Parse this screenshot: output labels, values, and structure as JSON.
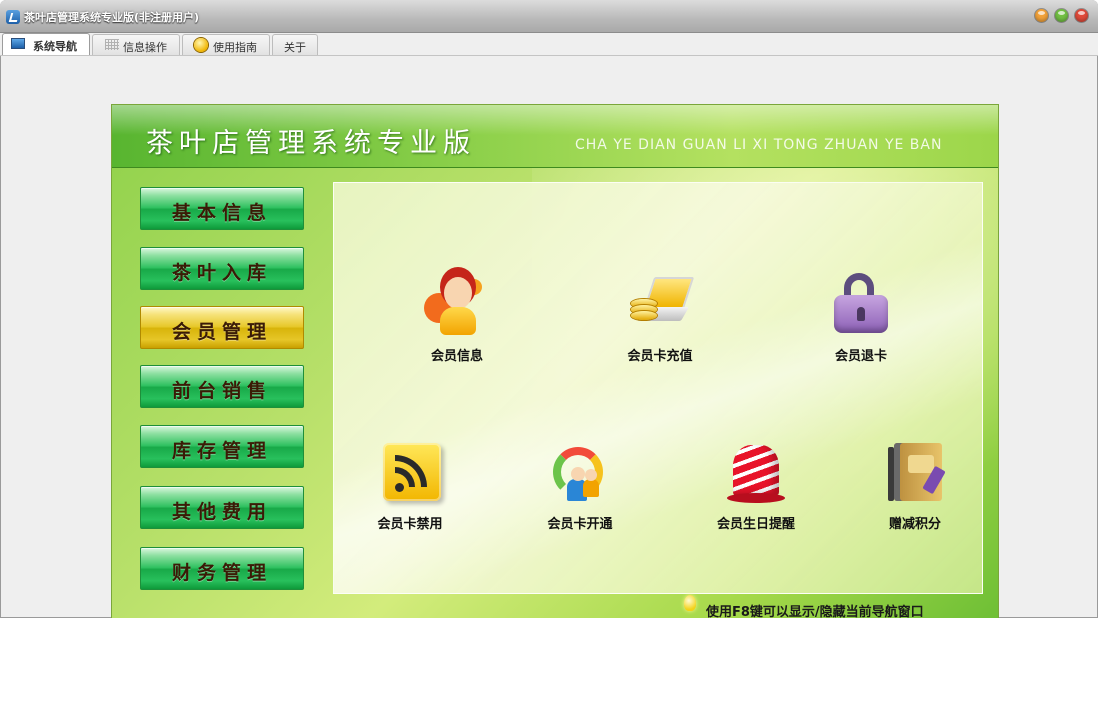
{
  "window": {
    "title": "茶叶店管理系统专业版(非注册用户)",
    "icons": [
      "app-logo-icon",
      "minimize-icon",
      "maximize-icon",
      "close-icon"
    ]
  },
  "tabs": [
    {
      "label": "系统导航",
      "icon": "monitor-icon",
      "active": true
    },
    {
      "label": "信息操作",
      "icon": "grid-icon",
      "active": false
    },
    {
      "label": "使用指南",
      "icon": "guide-icon",
      "active": false
    },
    {
      "label": "关于",
      "active": false
    }
  ],
  "banner": {
    "title_cn": "茶叶店管理系统专业版",
    "title_en": "CHA YE DIAN GUAN LI XI TONG ZHUAN YE BAN"
  },
  "sidebar": {
    "items": [
      {
        "label": "基本信息",
        "selected": false
      },
      {
        "label": "茶叶入库",
        "selected": false
      },
      {
        "label": "会员管理",
        "selected": true
      },
      {
        "label": "前台销售",
        "selected": false
      },
      {
        "label": "库存管理",
        "selected": false
      },
      {
        "label": "其他费用",
        "selected": false
      },
      {
        "label": "财务管理",
        "selected": false
      }
    ]
  },
  "modules": [
    {
      "label": "会员信息",
      "icon": "member-info-icon"
    },
    {
      "label": "会员卡充值",
      "icon": "card-recharge-icon"
    },
    {
      "label": "会员退卡",
      "icon": "lock-icon"
    },
    {
      "label": "会员卡禁用",
      "icon": "rss-disable-icon"
    },
    {
      "label": "会员卡开通",
      "icon": "rainbow-people-icon"
    },
    {
      "label": "会员生日提醒",
      "icon": "bell-icon"
    },
    {
      "label": "赠减积分",
      "icon": "points-book-icon"
    }
  ],
  "hint": {
    "text": "使用F8键可以显示/隐藏当前导航窗口",
    "icon": "lightbulb-icon"
  },
  "colors": {
    "accent_green": "#2fc160",
    "selected_gold": "#e7c82a",
    "label_brown": "#3a1b06"
  }
}
